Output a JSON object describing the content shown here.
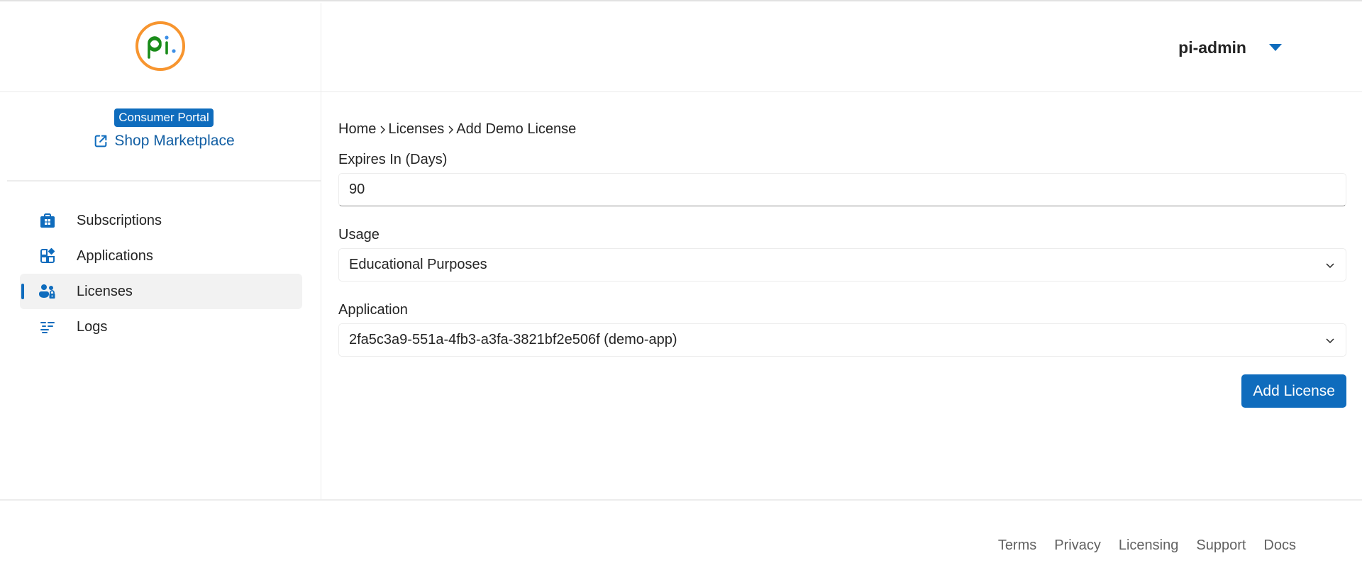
{
  "brand": {
    "logo_text": "pi.",
    "colors": {
      "ring": "#f7952f",
      "letters": "#1a8c1a",
      "dot": "#3d8fe6",
      "accent": "#0f6cbd"
    }
  },
  "header": {
    "user_name": "pi-admin",
    "user_menu_icon": "caret-down-icon"
  },
  "sidebar": {
    "portal_badge": "Consumer Portal",
    "shop_link": {
      "label": "Shop Marketplace",
      "icon": "external-link-icon"
    },
    "items": [
      {
        "label": "Subscriptions",
        "icon": "shopping-bag-icon",
        "active": false
      },
      {
        "label": "Applications",
        "icon": "apps-add-icon",
        "active": false
      },
      {
        "label": "Licenses",
        "icon": "people-lock-icon",
        "active": true
      },
      {
        "label": "Logs",
        "icon": "text-align-icon",
        "active": false
      }
    ]
  },
  "main": {
    "breadcrumb": [
      "Home",
      "Licenses",
      "Add Demo License"
    ],
    "form": {
      "expires": {
        "label": "Expires In (Days)",
        "value": "90"
      },
      "usage": {
        "label": "Usage",
        "selected": "Educational Purposes"
      },
      "application": {
        "label": "Application",
        "selected": "2fa5c3a9-551a-4fb3-a3fa-3821bf2e506f (demo-app)"
      },
      "submit_label": "Add License"
    }
  },
  "footer": {
    "links": [
      "Terms",
      "Privacy",
      "Licensing",
      "Support",
      "Docs"
    ]
  }
}
